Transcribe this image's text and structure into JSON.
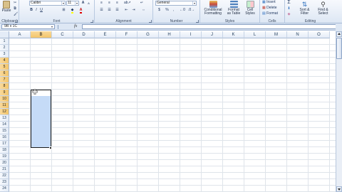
{
  "ribbon": {
    "clipboard": {
      "label": "Clipboard",
      "paste_label": "Paste"
    },
    "font": {
      "label": "Font",
      "font_name": "Calibri",
      "font_size": "11"
    },
    "alignment": {
      "label": "Alignment"
    },
    "number": {
      "label": "Number",
      "format": "General",
      "percent": "%"
    },
    "styles": {
      "label": "Styles",
      "conditional_formatting": "Conditional Formatting",
      "format_as_table": "Format as Table",
      "cell_styles": "Cell Styles"
    },
    "cells": {
      "label": "Cells",
      "insert": "Insert",
      "delete": "Delete",
      "format": "Format"
    },
    "editing": {
      "label": "Editing",
      "sort_filter": "Sort & Filter",
      "find_select": "Find & Select"
    }
  },
  "formula_bar": {
    "name_box": "9R x 1C",
    "fx": "fx",
    "formula": ""
  },
  "grid": {
    "columns": [
      "A",
      "B",
      "C",
      "D",
      "E",
      "F",
      "G",
      "H",
      "I",
      "J",
      "K",
      "L",
      "M",
      "N",
      "O"
    ],
    "selected_column": "B",
    "rows": [
      "1",
      "2",
      "3",
      "4",
      "5",
      "6",
      "7",
      "8",
      "9",
      "10",
      "11",
      "12",
      "13",
      "14",
      "15",
      "16",
      "17",
      "18",
      "19",
      "20",
      "21",
      "22",
      "23",
      "24"
    ],
    "selected_rows": [
      "4",
      "5",
      "6",
      "7",
      "8",
      "9",
      "10",
      "11",
      "12"
    ],
    "selection_range": "B4:B12"
  },
  "colors": {
    "selection_fill": "#c5dbf7",
    "header_highlight": "#f3c56a",
    "ribbon_bg": "#dde7f4"
  }
}
